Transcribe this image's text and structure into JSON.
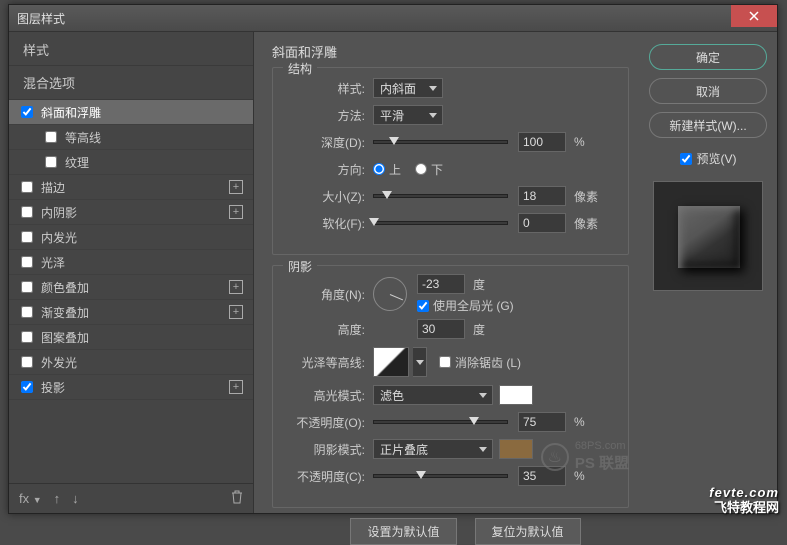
{
  "window": {
    "title": "图层样式"
  },
  "left": {
    "styles_header": "样式",
    "blend_header": "混合选项",
    "items": [
      {
        "label": "斜面和浮雕",
        "checked": true,
        "selected": true,
        "add": false,
        "sub": false
      },
      {
        "label": "等高线",
        "checked": false,
        "selected": false,
        "add": false,
        "sub": true
      },
      {
        "label": "纹理",
        "checked": false,
        "selected": false,
        "add": false,
        "sub": true
      },
      {
        "label": "描边",
        "checked": false,
        "selected": false,
        "add": true,
        "sub": false
      },
      {
        "label": "内阴影",
        "checked": false,
        "selected": false,
        "add": true,
        "sub": false
      },
      {
        "label": "内发光",
        "checked": false,
        "selected": false,
        "add": false,
        "sub": false
      },
      {
        "label": "光泽",
        "checked": false,
        "selected": false,
        "add": false,
        "sub": false
      },
      {
        "label": "颜色叠加",
        "checked": false,
        "selected": false,
        "add": true,
        "sub": false
      },
      {
        "label": "渐变叠加",
        "checked": false,
        "selected": false,
        "add": true,
        "sub": false
      },
      {
        "label": "图案叠加",
        "checked": false,
        "selected": false,
        "add": false,
        "sub": false
      },
      {
        "label": "外发光",
        "checked": false,
        "selected": false,
        "add": false,
        "sub": false
      },
      {
        "label": "投影",
        "checked": true,
        "selected": false,
        "add": true,
        "sub": false
      }
    ],
    "footer_fx": "fx"
  },
  "center": {
    "title": "斜面和浮雕",
    "struct_legend": "结构",
    "style_label": "样式:",
    "style_value": "内斜面",
    "method_label": "方法:",
    "method_value": "平滑",
    "depth_label": "深度(D):",
    "depth_value": "100",
    "depth_unit": "%",
    "direction_label": "方向:",
    "dir_up": "上",
    "dir_down": "下",
    "size_label": "大小(Z):",
    "size_value": "18",
    "size_unit": "像素",
    "soften_label": "软化(F):",
    "soften_value": "0",
    "soften_unit": "像素",
    "shadow_legend": "阴影",
    "angle_label": "角度(N):",
    "angle_value": "-23",
    "angle_unit": "度",
    "global_light": "使用全局光 (G)",
    "altitude_label": "高度:",
    "altitude_value": "30",
    "altitude_unit": "度",
    "gloss_contour_label": "光泽等高线:",
    "antialias": "消除锯齿 (L)",
    "highlight_mode_label": "高光模式:",
    "highlight_mode_value": "滤色",
    "highlight_color": "#ffffff",
    "highlight_opacity_label": "不透明度(O):",
    "highlight_opacity_value": "75",
    "highlight_opacity_unit": "%",
    "shadow_mode_label": "阴影模式:",
    "shadow_mode_value": "正片叠底",
    "shadow_color": "#8a6a3f",
    "shadow_opacity_label": "不透明度(C):",
    "shadow_opacity_value": "35",
    "shadow_opacity_unit": "%",
    "make_default": "设置为默认值",
    "reset_default": "复位为默认值"
  },
  "right": {
    "ok": "确定",
    "cancel": "取消",
    "new_style": "新建样式(W)...",
    "preview": "预览(V)"
  },
  "watermark": {
    "text1": "68PS.com",
    "text2": "PS 联盟",
    "wm2a": "fevte.com",
    "wm2b": "飞特教程网"
  }
}
